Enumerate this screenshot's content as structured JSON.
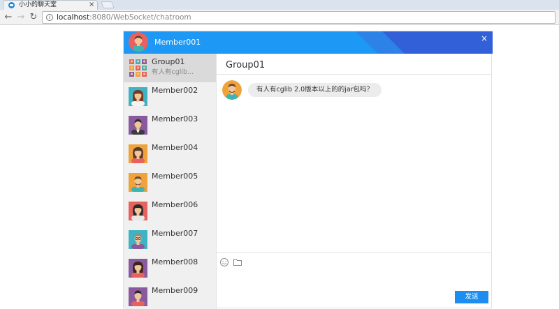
{
  "browser": {
    "tab_title": "小小的聊天室",
    "tab_close": "×",
    "url_host": "localhost",
    "url_rest": ":8080/WebSocket/chatroom",
    "info_glyph": "i"
  },
  "header": {
    "user_name": "Member001",
    "close_glyph": "×"
  },
  "contacts": [
    {
      "name": "Group01",
      "preview": "有人有cglib...",
      "active": true,
      "avatar": "group"
    },
    {
      "name": "Member002",
      "preview": "",
      "active": false,
      "avatar": "woman-teal"
    },
    {
      "name": "Member003",
      "preview": "",
      "active": false,
      "avatar": "man-purple"
    },
    {
      "name": "Member004",
      "preview": "",
      "active": false,
      "avatar": "woman-orange"
    },
    {
      "name": "Member005",
      "preview": "",
      "active": false,
      "avatar": "man-orange"
    },
    {
      "name": "Member006",
      "preview": "",
      "active": false,
      "avatar": "woman-red"
    },
    {
      "name": "Member007",
      "preview": "",
      "active": false,
      "avatar": "man-teal"
    },
    {
      "name": "Member008",
      "preview": "",
      "active": false,
      "avatar": "woman-purple"
    },
    {
      "name": "Member009",
      "preview": "",
      "active": false,
      "avatar": "man-purple-2"
    }
  ],
  "conversation": {
    "title": "Group01",
    "messages": [
      {
        "text": "有人有cglib 2.0版本以上的的jar包吗？"
      }
    ],
    "send_label": "发送",
    "icons": [
      "smiley-icon",
      "folder-icon"
    ]
  },
  "colors": {
    "header_blue": "#1e98f5",
    "send_blue": "#1d8ef0",
    "list_bg": "#f0f0f0",
    "active_item": "#dadada"
  }
}
